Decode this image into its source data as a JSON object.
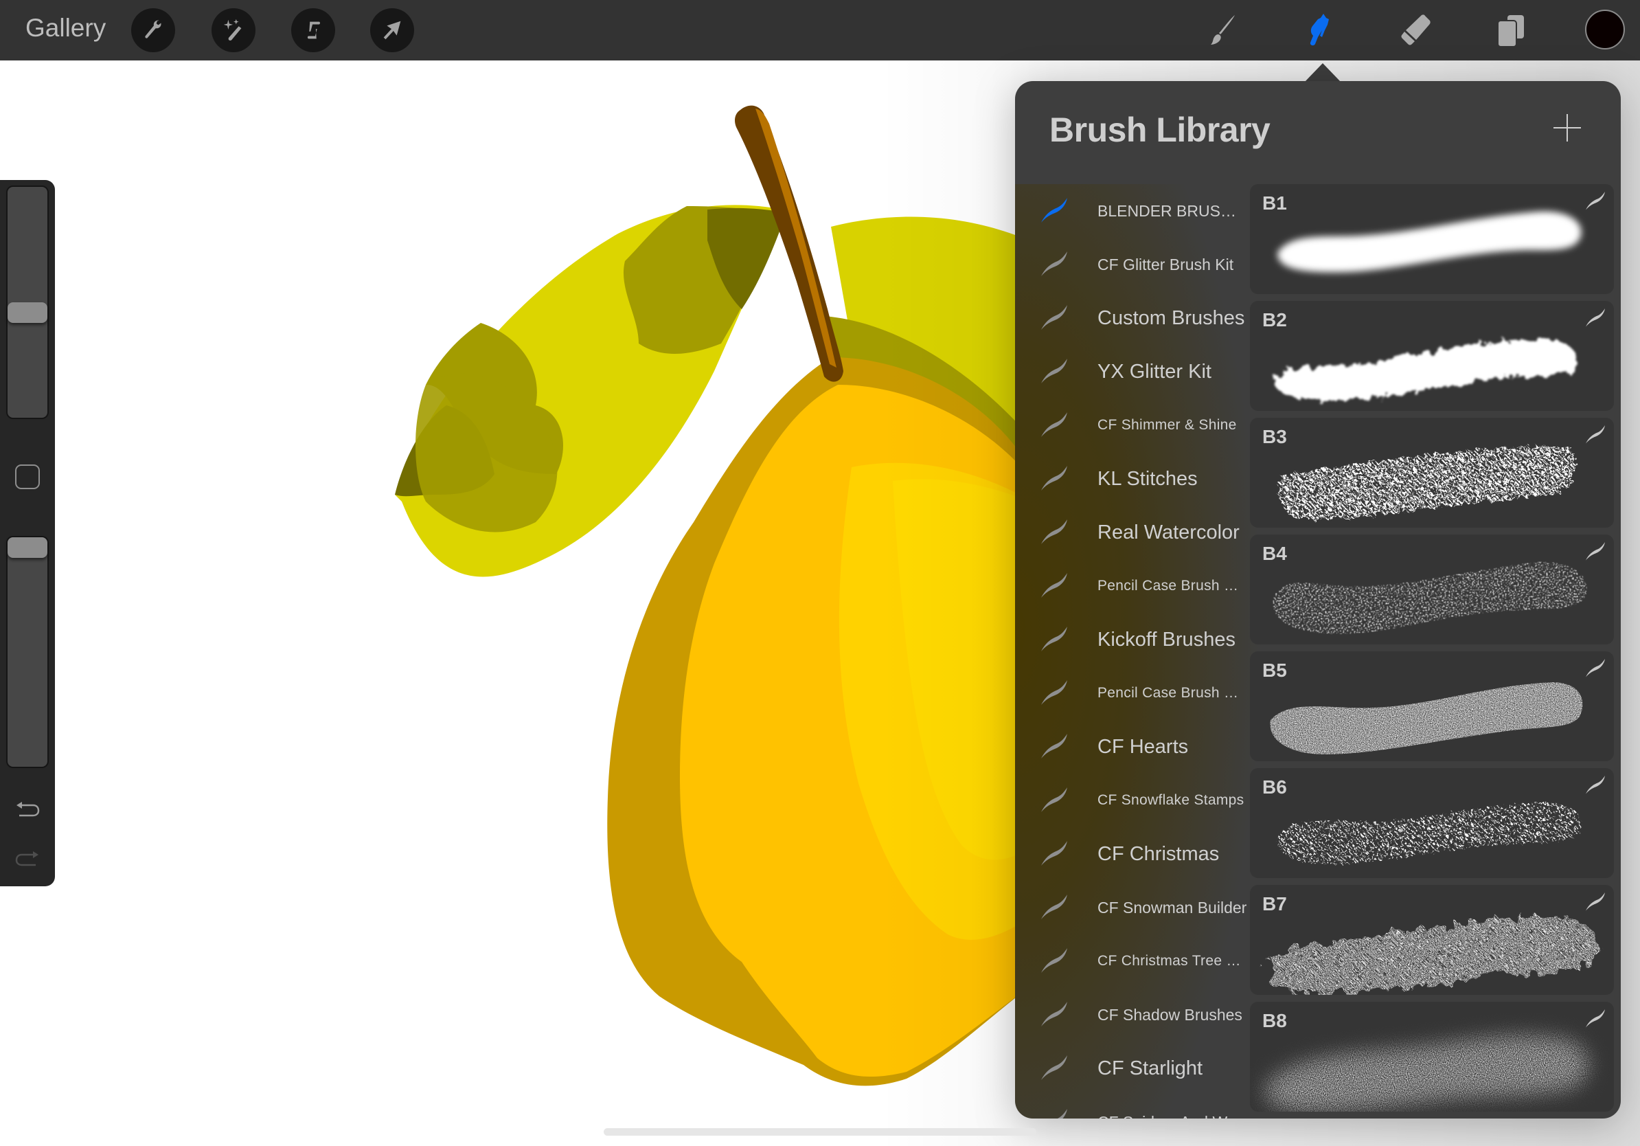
{
  "topbar": {
    "gallery_label": "Gallery",
    "left_tools": [
      {
        "name": "actions",
        "icon": "wrench-icon"
      },
      {
        "name": "adjustments",
        "icon": "magic-wand-icon"
      },
      {
        "name": "selection",
        "icon": "selection-s-icon"
      },
      {
        "name": "transform",
        "icon": "arrow-cursor-icon"
      }
    ],
    "right_tools": [
      {
        "name": "paint",
        "icon": "brush-icon",
        "active": false
      },
      {
        "name": "smudge",
        "icon": "smudge-finger-icon",
        "active": true
      },
      {
        "name": "erase",
        "icon": "eraser-icon",
        "active": false
      },
      {
        "name": "layers",
        "icon": "layers-icon",
        "active": false
      }
    ],
    "current_color": "#0a0000",
    "active_color": "#0a6cf0"
  },
  "sidebar": {
    "brush_size_fraction": 0.45,
    "opacity_fraction": 1.0,
    "modify_button": "modify-square-icon",
    "undo": "undo-icon",
    "redo": "redo-icon"
  },
  "brush_library": {
    "title": "Brush Library",
    "add_button": "plus-icon",
    "sets": [
      {
        "label": "BLENDER BRUSHES",
        "size": "m",
        "selected": true
      },
      {
        "label": "CF Glitter Brush Kit",
        "size": "m",
        "selected": false
      },
      {
        "label": "Custom Brushes",
        "size": "l",
        "selected": false
      },
      {
        "label": "YX Glitter Kit",
        "size": "l",
        "selected": false
      },
      {
        "label": "CF Shimmer & Shine",
        "size": "s",
        "selected": false
      },
      {
        "label": "KL Stitches",
        "size": "l",
        "selected": false
      },
      {
        "label": "Real Watercolor",
        "size": "l",
        "selected": false
      },
      {
        "label": "Pencil Case Brush Pa...",
        "size": "s",
        "selected": false
      },
      {
        "label": "Kickoff Brushes",
        "size": "l",
        "selected": false
      },
      {
        "label": "Pencil Case Brush Pa...",
        "size": "s",
        "selected": false
      },
      {
        "label": "CF Hearts",
        "size": "l",
        "selected": false
      },
      {
        "label": "CF Snowflake Stamps",
        "size": "s",
        "selected": false
      },
      {
        "label": "CF Christmas",
        "size": "l",
        "selected": false
      },
      {
        "label": "CF Snowman Builder",
        "size": "m",
        "selected": false
      },
      {
        "label": "CF Christmas Tree St...",
        "size": "s",
        "selected": false
      },
      {
        "label": "CF Shadow Brushes",
        "size": "m",
        "selected": false
      },
      {
        "label": "CF Starlight",
        "size": "l",
        "selected": false
      },
      {
        "label": "CF Spiders And Webs",
        "size": "m",
        "selected": false
      }
    ],
    "brushes": [
      {
        "label": "B1",
        "texture": "soft"
      },
      {
        "label": "B2",
        "texture": "cloudy"
      },
      {
        "label": "B3",
        "texture": "speckled"
      },
      {
        "label": "B4",
        "texture": "dry"
      },
      {
        "label": "B5",
        "texture": "grain"
      },
      {
        "label": "B6",
        "texture": "pebble"
      },
      {
        "label": "B7",
        "texture": "spray"
      },
      {
        "label": "B8",
        "texture": "mist"
      }
    ]
  },
  "canvas": {
    "subject": "lemon with leaf",
    "colors": {
      "leaf_light": "#dcd500",
      "leaf_mid": "#a39c00",
      "leaf_dark": "#726d00",
      "lemon_rim": "#c99a00",
      "lemon_body": "#ffc200",
      "lemon_highlight": "#ffd800",
      "stem_dark": "#6b3f00",
      "stem_light": "#b87300"
    }
  }
}
